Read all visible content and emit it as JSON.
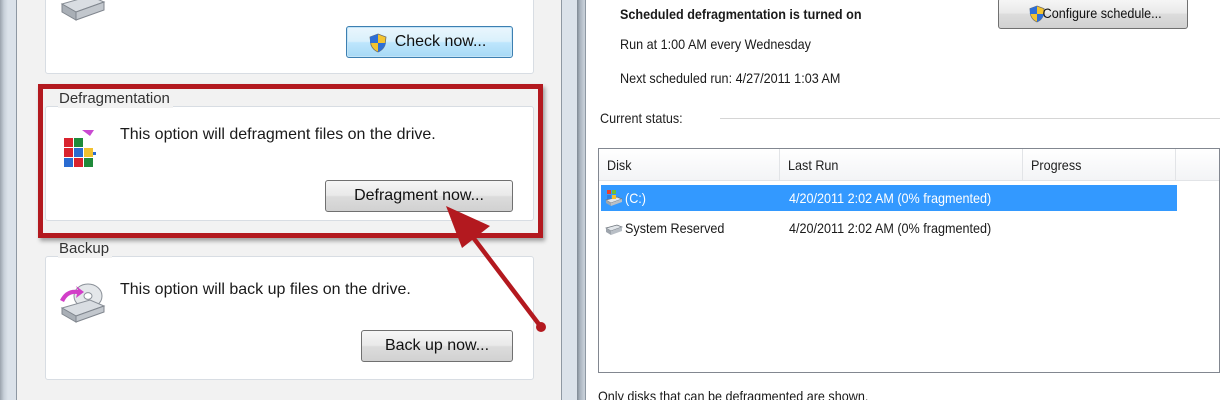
{
  "disk_check": {
    "check_button_label": "Check now..."
  },
  "defragmentation": {
    "group_title": "Defragmentation",
    "description": "This option will defragment files on the drive.",
    "button_label": "Defragment now..."
  },
  "backup": {
    "group_title": "Backup",
    "description": "This option will back up files on the drive.",
    "button_label": "Back up now..."
  },
  "schedule": {
    "title": "Scheduled defragmentation is turned on",
    "run_text": "Run at 1:00 AM every Wednesday",
    "next_run_text": "Next scheduled run: 4/27/2011 1:03 AM",
    "configure_button_label": "Configure schedule..."
  },
  "status": {
    "label": "Current status:",
    "columns": {
      "disk": "Disk",
      "last_run": "Last Run",
      "progress": "Progress"
    },
    "rows": [
      {
        "disk": "(C:)",
        "last_run": "4/20/2011 2:02 AM (0% fragmented)",
        "progress": "",
        "selected": true,
        "icon": "windows-drive-icon"
      },
      {
        "disk": "System Reserved",
        "last_run": "4/20/2011 2:02 AM (0% fragmented)",
        "progress": "",
        "selected": false,
        "icon": "drive-icon"
      }
    ],
    "footnote": "Only disks that can be defragmented are shown."
  },
  "annotation": {
    "highlight_color": "#b3191f",
    "arrow_color": "#b3191f"
  },
  "colors": {
    "selection": "#3399ff",
    "button_hover": "#bee6fd"
  }
}
